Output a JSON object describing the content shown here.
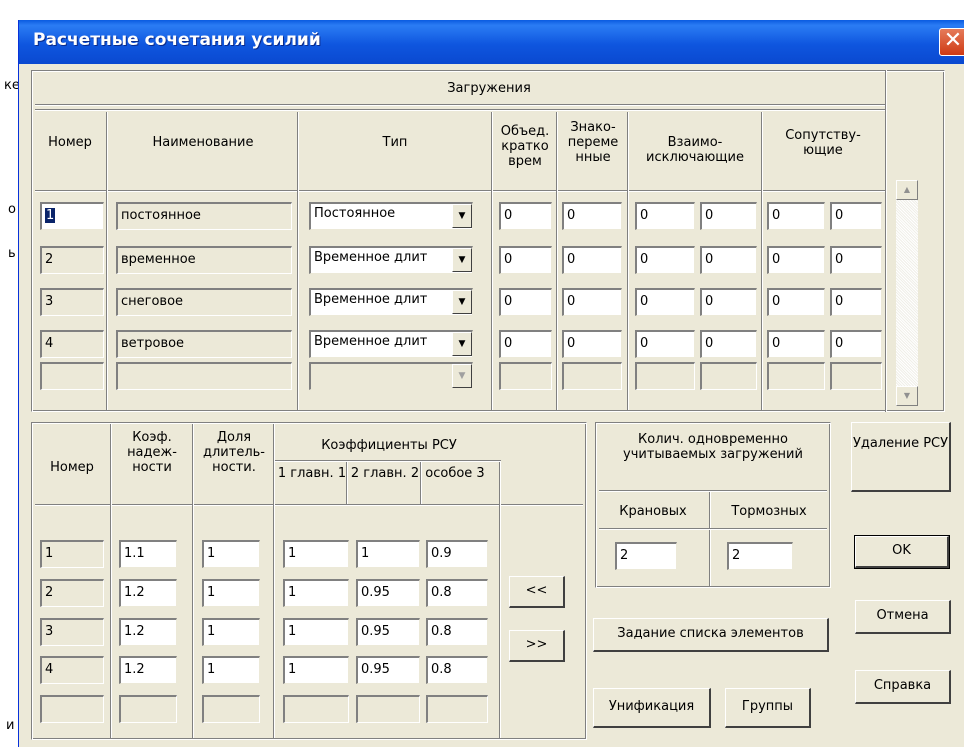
{
  "background_fragments": [
    "ке",
    "о",
    "ь",
    "и"
  ],
  "window": {
    "title": "Расчетные сочетания усилий",
    "close_symbol": "✕"
  },
  "loads": {
    "group_title": "Загружения",
    "headers": {
      "number": "Номер",
      "name": "Наименование",
      "type": "Тип",
      "combined": "Объед. кратко врем",
      "sign": "Знако- переме нные",
      "exclusive": "Взаимо- исключающие",
      "accompany": "Сопутству- ющие"
    },
    "rows": [
      {
        "num": "1",
        "name": "постоянное",
        "type": "Постоянное",
        "combined": "0",
        "sign": "0",
        "ex1": "0",
        "ex2": "0",
        "acc1": "0",
        "acc2": "0"
      },
      {
        "num": "2",
        "name": "временное",
        "type": "Временное длит",
        "combined": "0",
        "sign": "0",
        "ex1": "0",
        "ex2": "0",
        "acc1": "0",
        "acc2": "0"
      },
      {
        "num": "3",
        "name": "снеговое",
        "type": "Временное длит",
        "combined": "0",
        "sign": "0",
        "ex1": "0",
        "ex2": "0",
        "acc1": "0",
        "acc2": "0"
      },
      {
        "num": "4",
        "name": "ветровое",
        "type": "Временное длит",
        "combined": "0",
        "sign": "0",
        "ex1": "0",
        "ex2": "0",
        "acc1": "0",
        "acc2": "0"
      }
    ]
  },
  "coef": {
    "headers": {
      "number": "Номер",
      "reliability": "Коэф. надеж- ности",
      "duration": "Доля длитель- ности.",
      "rsu": "Коэффициенты РСУ",
      "main1": "1 главн. 1",
      "main2": "2 главн. 2",
      "special": "особое 3"
    },
    "rows": [
      {
        "num": "1",
        "rel": "1.1",
        "dur": "1",
        "m1": "1",
        "m2": "1",
        "sp": "0.9"
      },
      {
        "num": "2",
        "rel": "1.2",
        "dur": "1",
        "m1": "1",
        "m2": "0.95",
        "sp": "0.8"
      },
      {
        "num": "3",
        "rel": "1.2",
        "dur": "1",
        "m1": "1",
        "m2": "0.95",
        "sp": "0.8"
      },
      {
        "num": "4",
        "rel": "1.2",
        "dur": "1",
        "m1": "1",
        "m2": "0.95",
        "sp": "0.8"
      }
    ],
    "left_btn": "<<",
    "right_btn": ">>"
  },
  "simult": {
    "title": "Колич. одновременно учитываемых загружений",
    "crane_label": "Крановых",
    "brake_label": "Тормозных",
    "crane_value": "2",
    "brake_value": "2"
  },
  "buttons": {
    "elements": "Задание списка элементов",
    "unify": "Унификация",
    "groups": "Группы",
    "delete": "Удаление РСУ",
    "ok": "OK",
    "cancel": "Отмена",
    "help": "Справка"
  },
  "scroll": {
    "up": "▲",
    "down": "▼"
  }
}
